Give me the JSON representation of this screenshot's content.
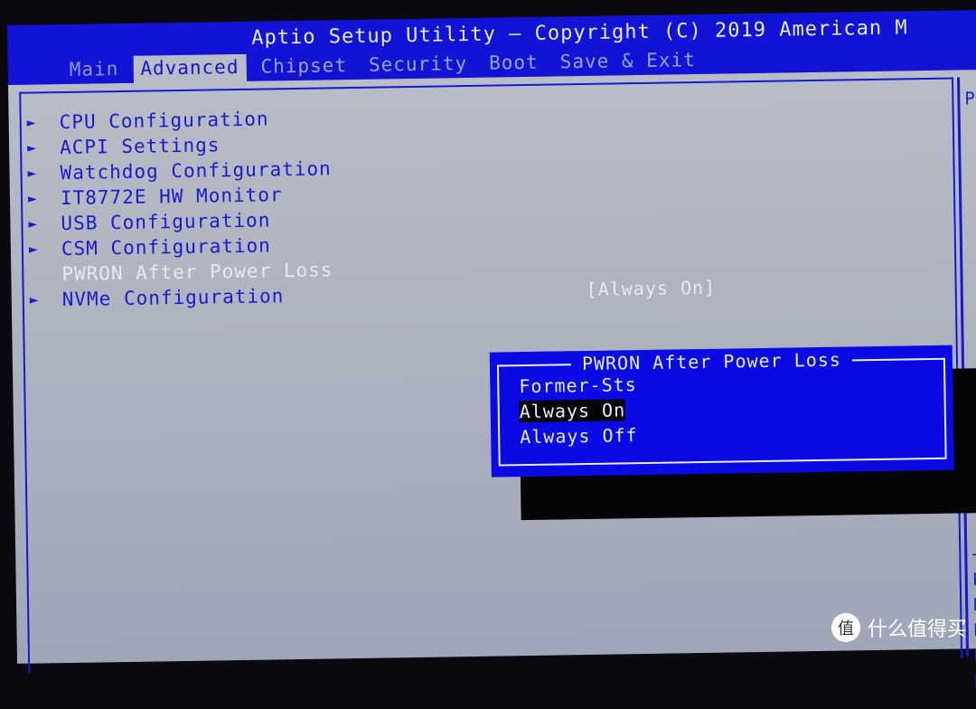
{
  "header": {
    "title": "Aptio Setup Utility – Copyright (C) 2019 American M"
  },
  "tabs": [
    {
      "label": "Main"
    },
    {
      "label": "Advanced"
    },
    {
      "label": "Chipset"
    },
    {
      "label": "Security"
    },
    {
      "label": "Boot"
    },
    {
      "label": "Save & Exit"
    }
  ],
  "active_tab": "Advanced",
  "menu": [
    {
      "label": "CPU Configuration",
      "submenu": true
    },
    {
      "label": "ACPI Settings",
      "submenu": true
    },
    {
      "label": "Watchdog Configuration",
      "submenu": true
    },
    {
      "label": "IT8772E HW Monitor",
      "submenu": true
    },
    {
      "label": "USB Configuration",
      "submenu": true
    },
    {
      "label": "CSM Configuration",
      "submenu": true
    },
    {
      "label": "PWRON After Power Loss",
      "submenu": false,
      "value": "[Always On]"
    },
    {
      "label": "NVMe Configuration",
      "submenu": true
    }
  ],
  "arrow": "►",
  "popup": {
    "title": "PWRON After Power Loss",
    "options": [
      "Former-Sts",
      "Always On",
      "Always Off"
    ],
    "selected": "Always On"
  },
  "help_column": [
    "P",
    "",
    "",
    "",
    "",
    "",
    "",
    "",
    "",
    "",
    "",
    "",
    "",
    "",
    "",
    "",
    "",
    "",
    "+",
    "F",
    "F",
    "F",
    "F",
    "E"
  ],
  "watermark": {
    "icon": "值",
    "text": "什么值得买"
  },
  "colors": {
    "header": "#1313d6",
    "text_blue": "#1a1acc",
    "popup": "#0a0ae4",
    "background": "#b7bcc6"
  }
}
